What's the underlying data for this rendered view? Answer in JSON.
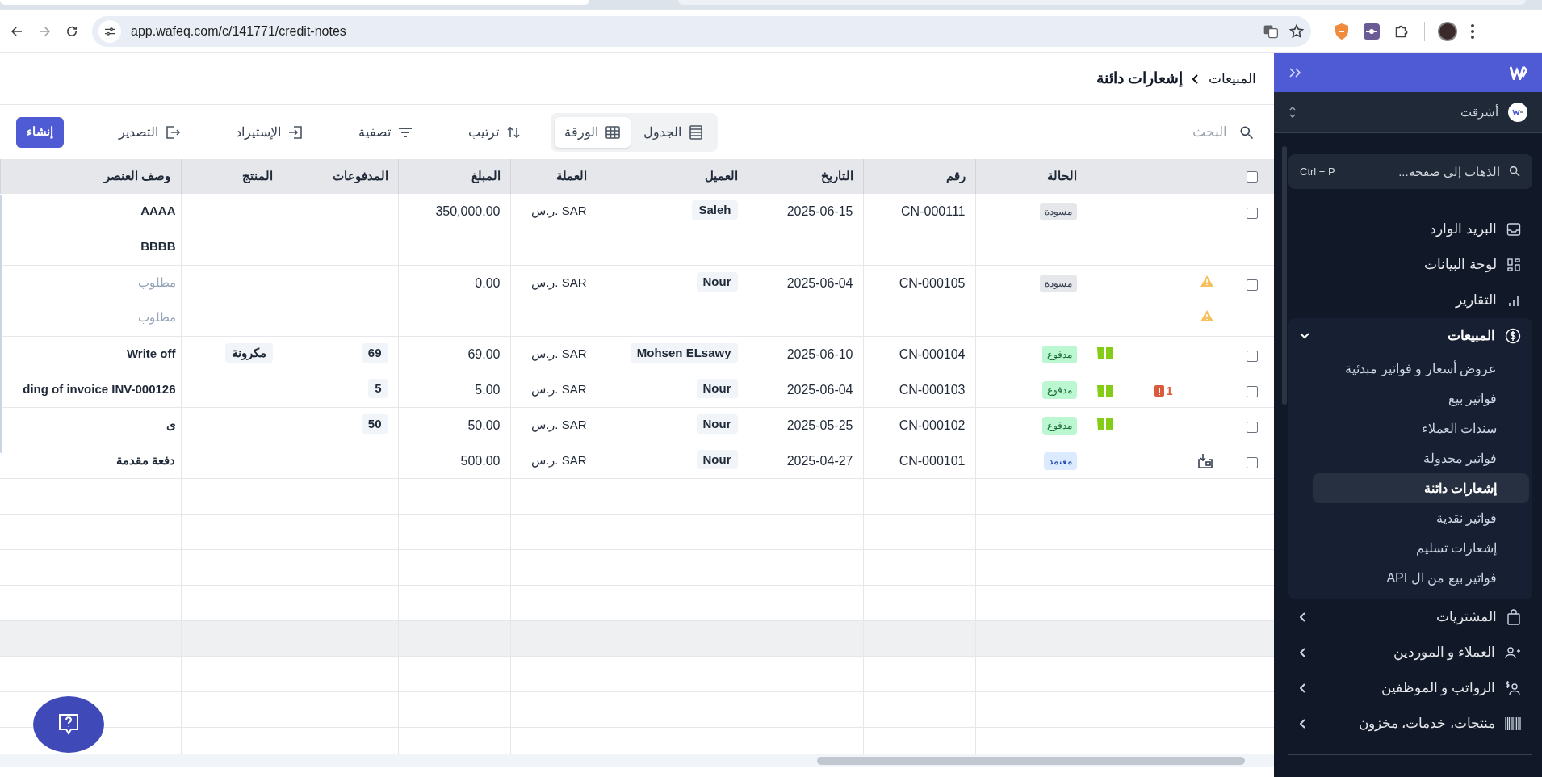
{
  "browser": {
    "url": "app.wafeq.com/c/141771/credit-notes"
  },
  "breadcrumb": [
    {
      "label": "المبيعات",
      "current": false
    },
    {
      "label": "إشعارات دائنة",
      "current": true
    }
  ],
  "toolbar": {
    "search": {
      "placeholder": "البحث"
    },
    "views": [
      {
        "label": "الجدول",
        "kind": "list",
        "selected": false
      },
      {
        "label": "الورقة",
        "kind": "grid",
        "selected": true
      }
    ],
    "actions": [
      {
        "label": "ترتيب",
        "kind": "sort"
      },
      {
        "label": "تصفية",
        "kind": "filter"
      },
      {
        "label": "الإستيراد",
        "kind": "import"
      },
      {
        "label": "التصدير",
        "kind": "export"
      }
    ],
    "create_button": "إنشاء"
  },
  "table": {
    "header_checked": false,
    "columns": [
      "الحالة",
      "رقم",
      "التاريخ",
      "العميل",
      "العملة",
      "المبلغ",
      "المدفوعات",
      "المنتج",
      "وصف العنصر"
    ],
    "rows": [
      {
        "checked": false,
        "indicators": [],
        "status": {
          "text": "مسودة",
          "kind": "draft"
        },
        "number": "CN-000111",
        "date": "2025-06-15",
        "customer": "Saleh",
        "currency": "ر.س. SAR",
        "amount": "350,000.00",
        "lines": [
          {
            "description": "AAAA",
            "kind": "value",
            "warning": false
          },
          {
            "description": "BBBB",
            "kind": "value",
            "warning": false
          }
        ]
      },
      {
        "checked": false,
        "indicators": [],
        "status": {
          "text": "مسودة",
          "kind": "draft"
        },
        "number": "CN-000105",
        "date": "2025-06-04",
        "customer": "Nour",
        "currency": "ر.س. SAR",
        "amount": "0.00",
        "lines": [
          {
            "description": "مطلوب",
            "kind": "required",
            "warning": true
          },
          {
            "description": "مطلوب",
            "kind": "required",
            "warning": true
          }
        ]
      },
      {
        "checked": false,
        "indicators": [
          {
            "kind": "book"
          }
        ],
        "status": {
          "text": "مدفوع",
          "kind": "paid"
        },
        "number": "CN-000104",
        "date": "2025-06-10",
        "customer": "Mohsen ELsawy",
        "currency": "ر.س. SAR",
        "amount": "69.00",
        "lines": [
          {
            "payment": "69",
            "product": "مكرونة",
            "description": "Write off",
            "kind": "value",
            "warning": false
          }
        ]
      },
      {
        "checked": false,
        "indicators": [
          {
            "kind": "book"
          },
          {
            "kind": "errors",
            "text": "1"
          }
        ],
        "status": {
          "text": "مدفوع",
          "kind": "paid"
        },
        "number": "CN-000103",
        "date": "2025-06-04",
        "customer": "Nour",
        "currency": "ر.س. SAR",
        "amount": "5.00",
        "lines": [
          {
            "payment": "5",
            "description": "ding of invoice INV-000126",
            "kind": "value",
            "warning": false
          }
        ]
      },
      {
        "checked": false,
        "indicators": [
          {
            "kind": "book"
          }
        ],
        "status": {
          "text": "مدفوع",
          "kind": "paid"
        },
        "number": "CN-000102",
        "date": "2025-05-25",
        "customer": "Nour",
        "currency": "ر.س. SAR",
        "amount": "50.00",
        "lines": [
          {
            "payment": "50",
            "description": "ى",
            "kind": "value",
            "warning": false
          }
        ]
      },
      {
        "checked": false,
        "indicators": [
          {
            "kind": "download"
          }
        ],
        "status": {
          "text": "معتمد",
          "kind": "approved"
        },
        "number": "CN-000101",
        "date": "2025-04-27",
        "customer": "Nour",
        "currency": "ر.س. SAR",
        "amount": "500.00",
        "lines": [
          {
            "description": "دفعة مقدمة",
            "kind": "value",
            "warning": false
          }
        ]
      }
    ]
  },
  "sidebar": {
    "org": "أشرقت",
    "goto": {
      "placeholder": "الذهاب إلى صفحة...",
      "shortcut": "Ctrl + P"
    },
    "items": [
      {
        "label": "البريد الوارد",
        "kind": "link"
      },
      {
        "label": "لوحة البيانات",
        "kind": "link"
      },
      {
        "label": "التقارير",
        "kind": "link"
      },
      {
        "label": "المبيعات",
        "kind": "group",
        "expanded": true,
        "children": [
          {
            "label": "عروض أسعار و فواتير مبدئية",
            "selected": false
          },
          {
            "label": "فواتير بيع",
            "selected": false
          },
          {
            "label": "سندات العملاء",
            "selected": false
          },
          {
            "label": "فواتير مجدولة",
            "selected": false
          },
          {
            "label": "إشعارات دائنة",
            "selected": true
          },
          {
            "label": "فواتير نقدية",
            "selected": false
          },
          {
            "label": "إشعارات تسليم",
            "selected": false
          },
          {
            "label": "فواتير بيع من ال API",
            "selected": false
          }
        ]
      },
      {
        "label": "المشتريات",
        "kind": "group",
        "expanded": false
      },
      {
        "label": "العملاء و الموردين",
        "kind": "group",
        "expanded": false
      },
      {
        "label": "الرواتب و الموظفين",
        "kind": "group",
        "expanded": false
      },
      {
        "label": "منتجات، خدمات، مخزون",
        "kind": "group",
        "expanded": false
      }
    ]
  }
}
